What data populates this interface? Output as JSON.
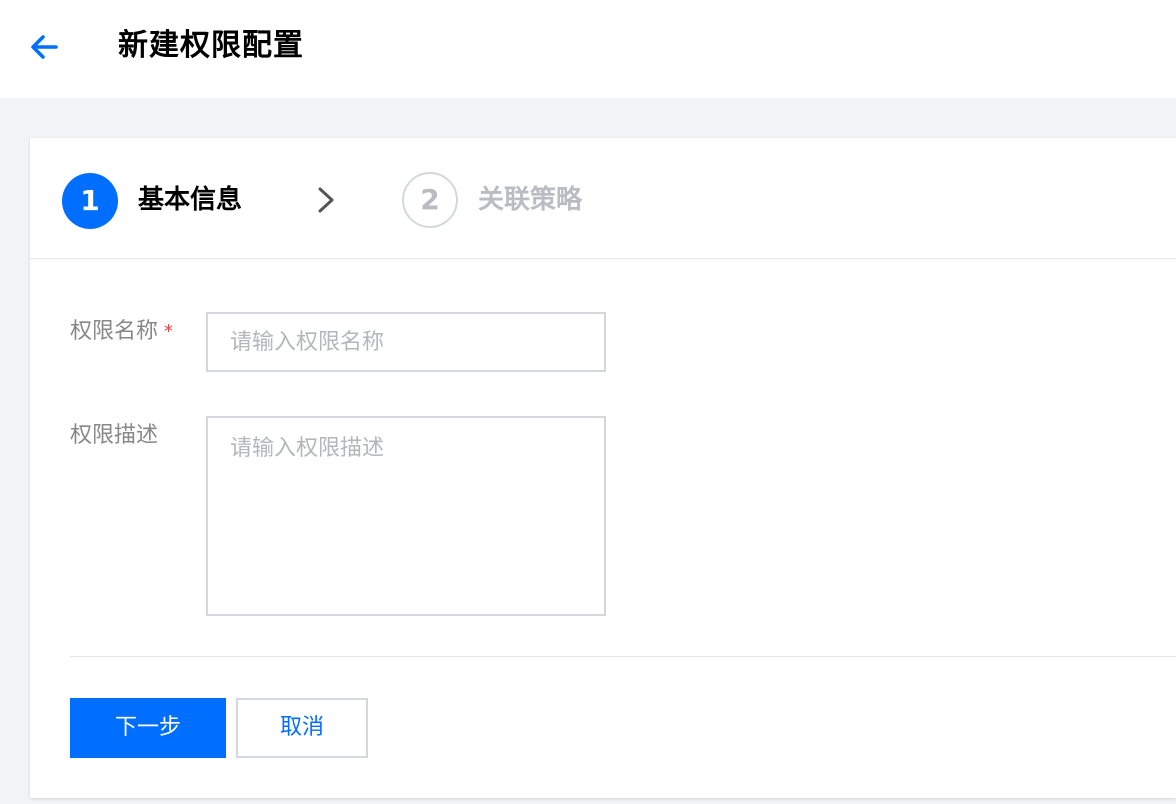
{
  "header": {
    "title": "新建权限配置",
    "back_icon": "arrow-left-icon",
    "accent_color": "#006eff"
  },
  "steps": [
    {
      "number": "1",
      "label": "基本信息",
      "state": "active"
    },
    {
      "number": "2",
      "label": "关联策略",
      "state": "inactive"
    }
  ],
  "step_separator_icon": "chevron-right-icon",
  "form": {
    "name": {
      "label": "权限名称",
      "required_mark": "*",
      "value": "",
      "placeholder": "请输入权限名称"
    },
    "description": {
      "label": "权限描述",
      "value": "",
      "placeholder": "请输入权限描述"
    }
  },
  "actions": {
    "next_label": "下一步",
    "cancel_label": "取消"
  }
}
